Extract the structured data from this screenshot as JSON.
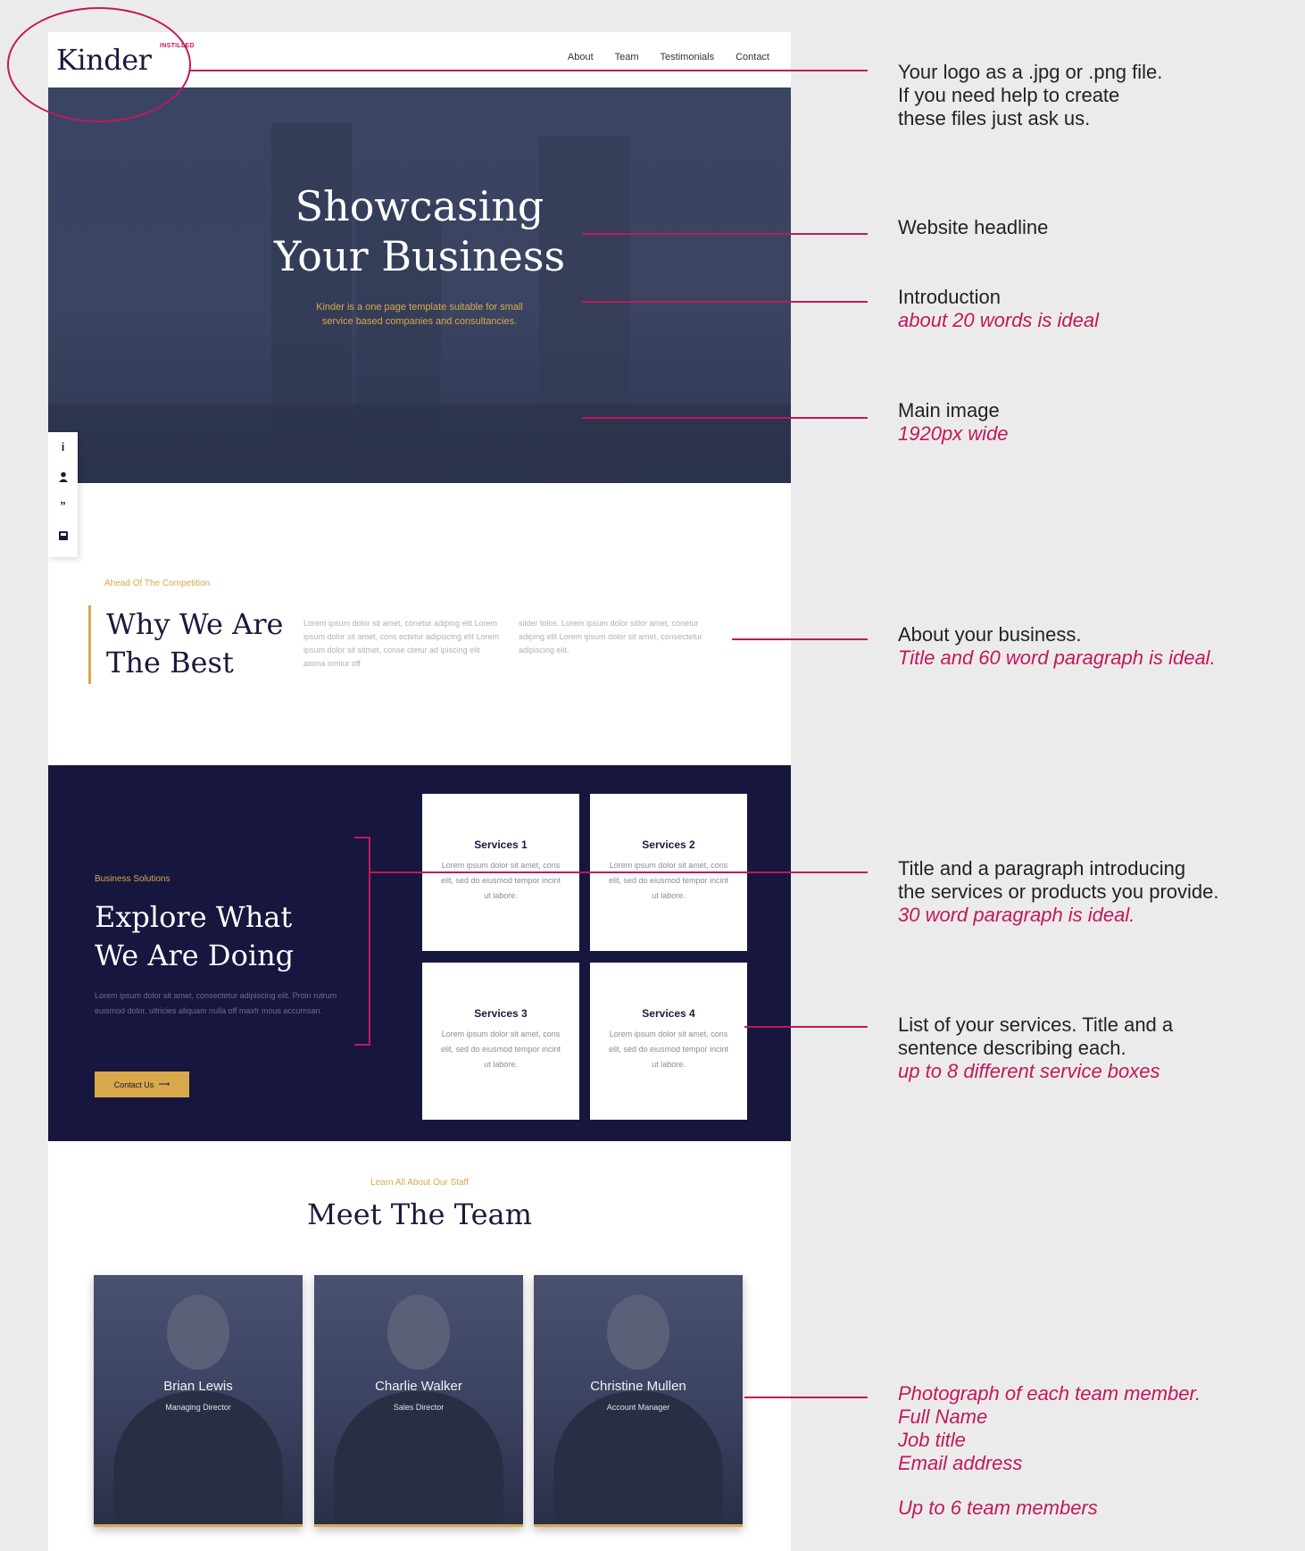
{
  "header": {
    "logo": "Kinder",
    "logo_badge": "INSTILLED",
    "nav": [
      "About",
      "Team",
      "Testimonials",
      "Contact"
    ]
  },
  "hero": {
    "title_line1": "Showcasing",
    "title_line2": "Your Business",
    "intro_line1": "Kinder is a one page template suitable for small",
    "intro_line2": "service based companies and consultancies."
  },
  "about": {
    "kicker": "Ahead Of The Competition",
    "title_line1": "Why We Are",
    "title_line2": "The Best",
    "col1": "Lorem ipsum dolor sit amet, conetur adiping elit Lorem ipsum dolor sit amet, cons ectetur adipiscing elit Lorem ipsum dolor sit sitmet, conse ctetur ad ipiscing elit aioma iomiur off",
    "col2": "silder tolos. Lorem ipsum dolor sitlor amet, conetur adiping elit Lorem ipsum dolor sit amet, consectetur adipiscing elit."
  },
  "services": {
    "kicker": "Business Solutions",
    "title_line1": "Explore What",
    "title_line2": "We Are Doing",
    "paragraph": "Lorem ipsum dolor sit amet, consectetur adipiscing elit. Proin rutrum euismod dolor, ultricies aliquam nulla off maxfr mous accumsan.",
    "button": "Contact Us",
    "cards": [
      {
        "title": "Services 1",
        "desc": "Lorem ipsum dolor sit amet, cons elit, sed do eiusmod tempor incint ut labore."
      },
      {
        "title": "Services 2",
        "desc": "Lorem ipsum dolor sit amet, cons elit, sed do eiusmod tempor incint ut labore."
      },
      {
        "title": "Services 3",
        "desc": "Lorem ipsum dolor sit amet, cons elit, sed do eiusmod tempor incint ut labore."
      },
      {
        "title": "Services 4",
        "desc": "Lorem ipsum dolor sit amet, cons elit, sed do eiusmod tempor incint ut labore."
      }
    ]
  },
  "team": {
    "kicker": "Learn All About Our Staff",
    "title": "Meet The Team",
    "members": [
      {
        "name": "Brian Lewis",
        "job": "Managing Director"
      },
      {
        "name": "Charlie Walker",
        "job": "Sales Director"
      },
      {
        "name": "Christine Mullen",
        "job": "Account Manager"
      }
    ]
  },
  "annotations": {
    "logo": [
      "Your logo as a .jpg or .png file.",
      "If you need help to create",
      "these files just ask us."
    ],
    "headline": "Website headline",
    "intro": "Introduction",
    "intro_note": "about 20 words is ideal",
    "image": "Main image",
    "image_note": "1920px wide",
    "about": "About your business.",
    "about_note": "Title and 60 word paragraph is ideal.",
    "services_intro": [
      "Title and a paragraph introducing",
      "the services or products you provide."
    ],
    "services_intro_note": "30 word paragraph is ideal.",
    "services_list": [
      "List of your services. Title and a",
      "sentence describing each."
    ],
    "services_list_note": "up to 8 different service boxes",
    "team_notes": [
      "Photograph of each team member.",
      "Full Name",
      "Job title",
      "Email address"
    ],
    "team_limit": "Up to 6 team members"
  },
  "colors": {
    "accent": "#c2185b",
    "gold": "#d8a94a",
    "navy": "#16163e"
  }
}
